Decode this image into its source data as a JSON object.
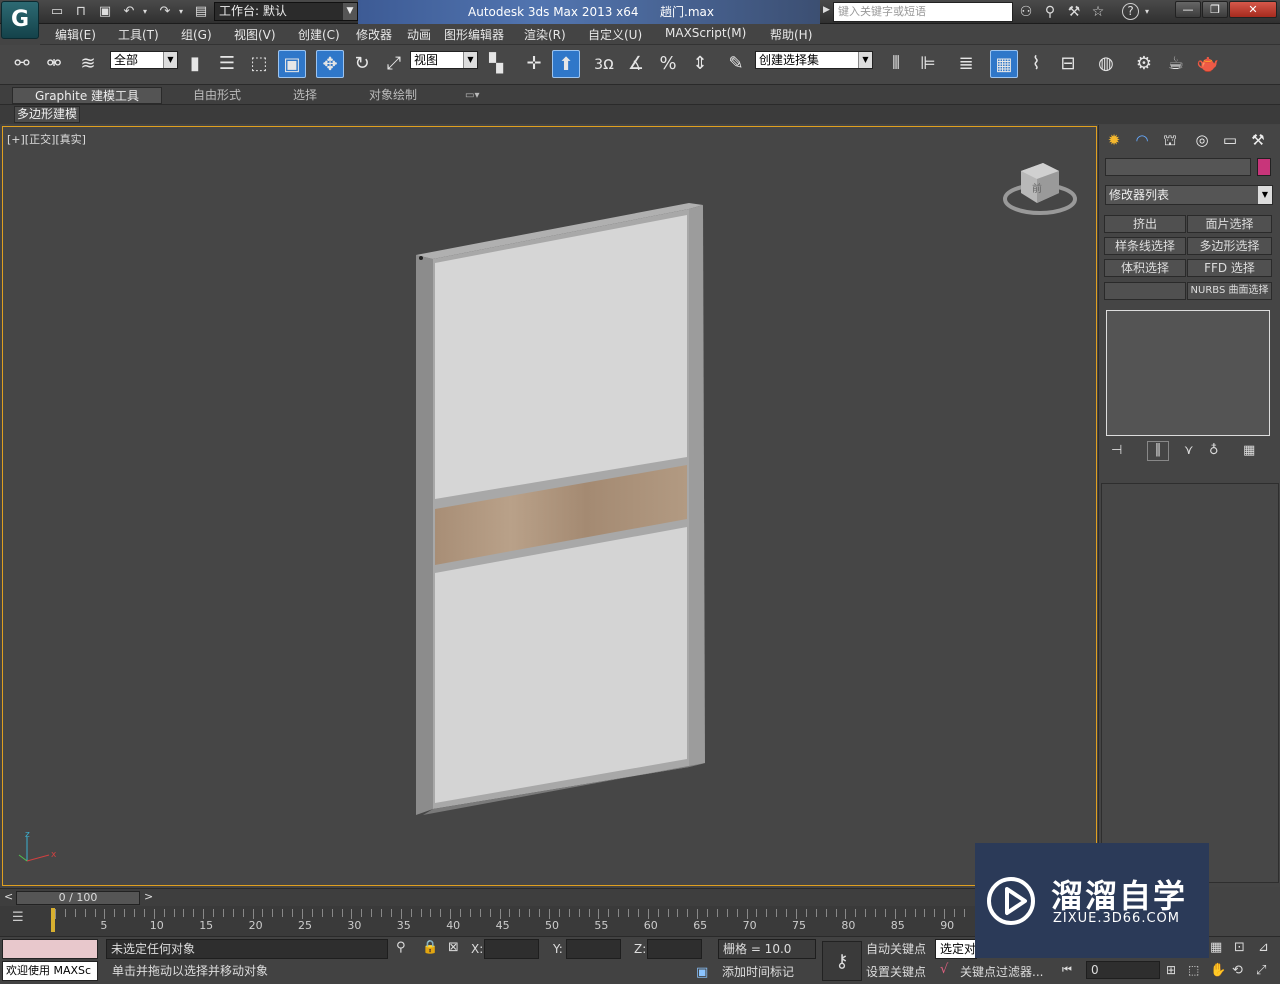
{
  "titlebar": {
    "app_letter": "G",
    "workspace_label": "工作台: 默认",
    "app_title": "Autodesk 3ds Max  2013 x64",
    "file_name": "趟门.max",
    "search_placeholder": "键入关键字或短语"
  },
  "menu": [
    "编辑(E)",
    "工具(T)",
    "组(G)",
    "视图(V)",
    "创建(C)",
    "修改器",
    "动画",
    "图形编辑器",
    "渲染(R)",
    "自定义(U)",
    "MAXScript(M)",
    "帮助(H)"
  ],
  "toolbar": {
    "selection_filter": "全部",
    "ref_coord": "视图",
    "snap_3": "3",
    "named_selection": "创建选择集"
  },
  "ribbon": {
    "tabs": [
      "Graphite 建模工具",
      "自由形式",
      "选择",
      "对象绘制"
    ],
    "sub_tab": "多边形建模"
  },
  "viewport": {
    "label": "[+][正交][真实]",
    "viewcube_face": "前",
    "axis_x": "x",
    "axis_z": "z"
  },
  "cmd_panel": {
    "modifier_list": "修改器列表",
    "buttons": [
      "挤出",
      "面片选择",
      "样条线选择",
      "多边形选择",
      "体积选择",
      "FFD 选择",
      "",
      "NURBS 曲面选择"
    ],
    "color": "#c8357a"
  },
  "timeline": {
    "frame_display": "0 / 100",
    "ticks": [
      "5",
      "10",
      "15",
      "20",
      "25",
      "30",
      "35",
      "40",
      "45",
      "50",
      "55",
      "60",
      "65",
      "70",
      "75",
      "80",
      "85",
      "90"
    ]
  },
  "status": {
    "welcome": "欢迎使用 MAXSc",
    "selection_msg": "未选定任何对象",
    "prompt_msg": "单击并拖动以选择并移动对象",
    "x_label": "X:",
    "y_label": "Y:",
    "z_label": "Z:",
    "grid": "栅格 = 10.0",
    "add_time_tag": "添加时间标记",
    "auto_key": "自动关键点",
    "selected": "选定对",
    "set_key": "设置关键点",
    "key_filter": "关键点过滤器...",
    "frame": "0"
  },
  "watermark": {
    "brand": "溜溜自学",
    "url": "ZIXUE.3D66.COM"
  }
}
